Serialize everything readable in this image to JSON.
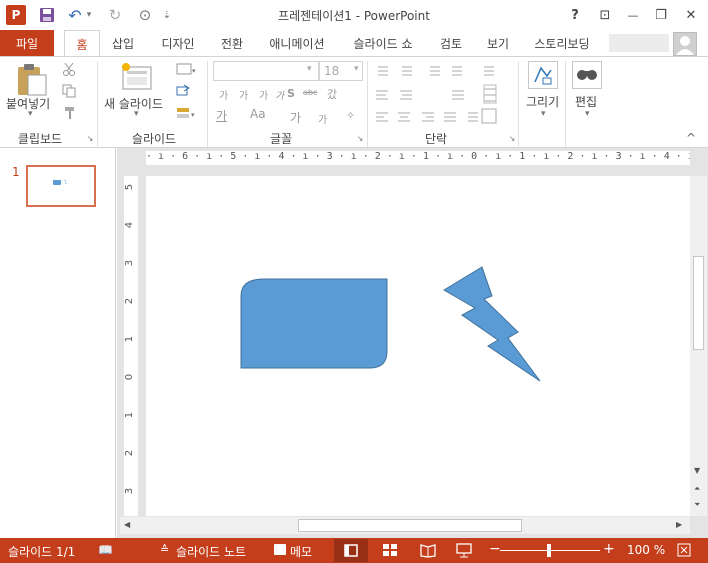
{
  "app": {
    "title": "프레젠테이션1 - PowerPoint"
  },
  "quick_access": {
    "app_icon_label": "P",
    "save_glyph": "💾",
    "undo_glyph": "↶",
    "undo_arrow": "▾",
    "redo_glyph": "↻",
    "present_glyph": "⊙",
    "customize_glyph": "⇣"
  },
  "window_controls": {
    "help": "?",
    "ribbon_display": "⊡",
    "minimize": "—",
    "restore": "❐",
    "close": "✕"
  },
  "tabs": [
    {
      "label": "파일"
    },
    {
      "label": "홈"
    },
    {
      "label": "삽입"
    },
    {
      "label": "디자인"
    },
    {
      "label": "전환"
    },
    {
      "label": "애니메이션"
    },
    {
      "label": "슬라이드 쇼"
    },
    {
      "label": "검토"
    },
    {
      "label": "보기"
    },
    {
      "label": "스토리보딩"
    }
  ],
  "ribbon": {
    "groups": {
      "clipboard": "클립보드",
      "slides": "슬라이드",
      "font": "글꼴",
      "paragraph": "단락"
    },
    "paste_label": "붙여넣기",
    "paste_arrow": "▾",
    "new_slide_label": "새 슬라이드",
    "new_slide_arrow": "▾",
    "font_size": "18",
    "font_dropdown_arrow": "▾",
    "size_dropdown_arrow": "▾",
    "grow_font": "가",
    "shrink_font": "가",
    "clear_format": "✧",
    "bold": "가",
    "italic": "가",
    "underline": "가",
    "shadow": "S",
    "strike": "abc",
    "char_spacing": "갔",
    "font_color": "가",
    "case": "Aa",
    "highlight": "가",
    "highlight_small": "가",
    "drawing_label": "그리기",
    "drawing_arrow": "▾",
    "edit_label": "편집",
    "edit_arrow": "▾",
    "collapse": "^"
  },
  "slide_panel": {
    "slide_number": "1"
  },
  "ruler": {
    "horizontal": "· ı · 6 · ı · 5 · ı · 4 · ı · 3 · ı · 2 · ı · 1 · ı · 0 · ı · 1 · ı · 2 · ı · 3 · ı · 4 · ı · 5 · ı · 6 · ı · 7 ·",
    "vertical": [
      "5",
      "4",
      "3",
      "2",
      "1",
      "0",
      "1",
      "2",
      "3"
    ]
  },
  "status": {
    "slide_info": "슬라이드 1/1",
    "notes_label": "슬라이드 노트",
    "comments_label": "메모",
    "zoom_minus": "−",
    "zoom_plus": "+",
    "zoom": "100 %"
  },
  "shape_colors": {
    "fill": "#5b9bd5",
    "stroke": "#41719c",
    "accent": "#c43e1c"
  }
}
